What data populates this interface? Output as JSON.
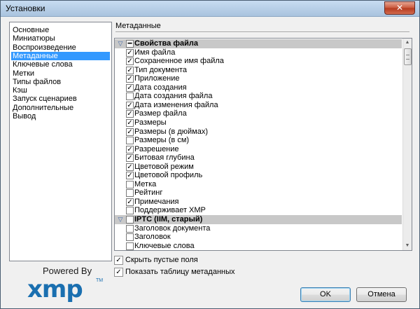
{
  "window": {
    "title": "Установки",
    "close_glyph": "✕"
  },
  "nav": {
    "items": [
      {
        "label": "Основные",
        "selected": false
      },
      {
        "label": "Миниатюры",
        "selected": false
      },
      {
        "label": "Воспроизведение",
        "selected": false
      },
      {
        "label": "Метаданные",
        "selected": true
      },
      {
        "label": "Ключевые слова",
        "selected": false
      },
      {
        "label": "Метки",
        "selected": false
      },
      {
        "label": "Типы файлов",
        "selected": false
      },
      {
        "label": "Кэш",
        "selected": false
      },
      {
        "label": "Запуск сценариев",
        "selected": false
      },
      {
        "label": "Дополнительные",
        "selected": false
      },
      {
        "label": "Вывод",
        "selected": false
      }
    ]
  },
  "section_title": "Метаданные",
  "metadata": {
    "rows": [
      {
        "label": "Свойства файла",
        "section": true,
        "state": "partial"
      },
      {
        "label": "Имя файла",
        "checked": true
      },
      {
        "label": "Сохраненное имя файла",
        "checked": true
      },
      {
        "label": "Тип документа",
        "checked": true
      },
      {
        "label": "Приложение",
        "checked": true
      },
      {
        "label": "Дата создания",
        "checked": true
      },
      {
        "label": "Дата создания файла",
        "checked": false
      },
      {
        "label": "Дата изменения файла",
        "checked": true
      },
      {
        "label": "Размер файла",
        "checked": true
      },
      {
        "label": "Размеры",
        "checked": true
      },
      {
        "label": "Размеры (в дюймах)",
        "checked": true
      },
      {
        "label": "Размеры (в см)",
        "checked": false
      },
      {
        "label": "Разрешение",
        "checked": true
      },
      {
        "label": "Битовая глубина",
        "checked": true
      },
      {
        "label": "Цветовой режим",
        "checked": true
      },
      {
        "label": "Цветовой профиль",
        "checked": true
      },
      {
        "label": "Метка",
        "checked": false
      },
      {
        "label": "Рейтинг",
        "checked": false
      },
      {
        "label": "Примечания",
        "checked": true
      },
      {
        "label": "Поддерживает XMP",
        "checked": false
      },
      {
        "label": "IPTC (IIM, старый)",
        "section": true,
        "state": "unchecked"
      },
      {
        "label": "Заголовок документа",
        "checked": false
      },
      {
        "label": "Заголовок",
        "checked": false
      },
      {
        "label": "Ключевые слова",
        "checked": false
      }
    ]
  },
  "options": [
    {
      "label": "Скрыть пустые поля",
      "checked": true
    },
    {
      "label": "Показать таблицу метаданных",
      "checked": true
    }
  ],
  "logo": {
    "powered_by": "Powered By",
    "brand": "xmp",
    "tm": "TM"
  },
  "buttons": {
    "ok": "OK",
    "cancel": "Отмена"
  },
  "colors": {
    "selection": "#3399ff",
    "section_row": "#c8c8c8",
    "brand": "#1a6fb0"
  }
}
